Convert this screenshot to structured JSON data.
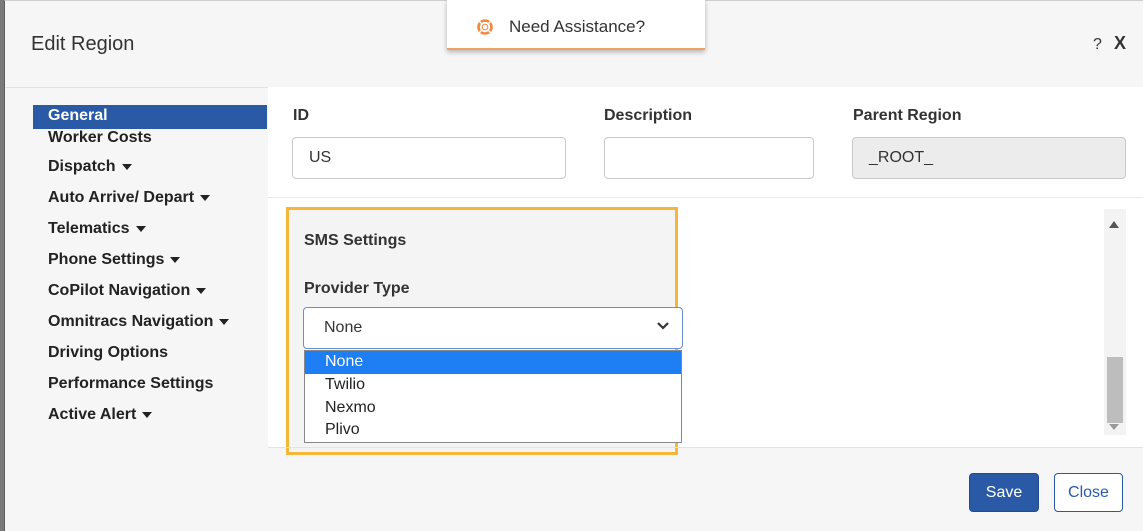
{
  "dialog": {
    "title": "Edit Region",
    "help_label": "?",
    "close_label": "X"
  },
  "assist": {
    "label": "Need Assistance?",
    "icon": "assistance-icon"
  },
  "nav": {
    "items": [
      {
        "label": "General",
        "active": true
      },
      {
        "label": "Worker Costs"
      },
      {
        "label": "Dispatch",
        "dropdown": true
      },
      {
        "label": "Auto Arrive/ Depart",
        "dropdown": true
      },
      {
        "label": "Telematics",
        "dropdown": true
      },
      {
        "label": "Phone Settings",
        "dropdown": true
      },
      {
        "label": "CoPilot Navigation",
        "dropdown": true
      },
      {
        "label": "Omnitracs Navigation",
        "dropdown": true
      },
      {
        "label": "Driving Options"
      },
      {
        "label": "Performance Settings"
      },
      {
        "label": "Active Alert",
        "dropdown": true
      }
    ]
  },
  "form": {
    "id_label": "ID",
    "id_value": "US",
    "description_label": "Description",
    "description_value": "",
    "parent_label": "Parent Region",
    "parent_value": "_ROOT_"
  },
  "sms": {
    "title": "SMS Settings",
    "provider_label": "Provider Type",
    "selected": "None",
    "options": [
      "None",
      "Twilio",
      "Nexmo",
      "Plivo"
    ]
  },
  "footer": {
    "save_label": "Save",
    "close_label": "Close"
  },
  "colors": {
    "primary": "#2a59a6",
    "highlight": "#f5b63a",
    "option_selected": "#1e7ff5"
  }
}
